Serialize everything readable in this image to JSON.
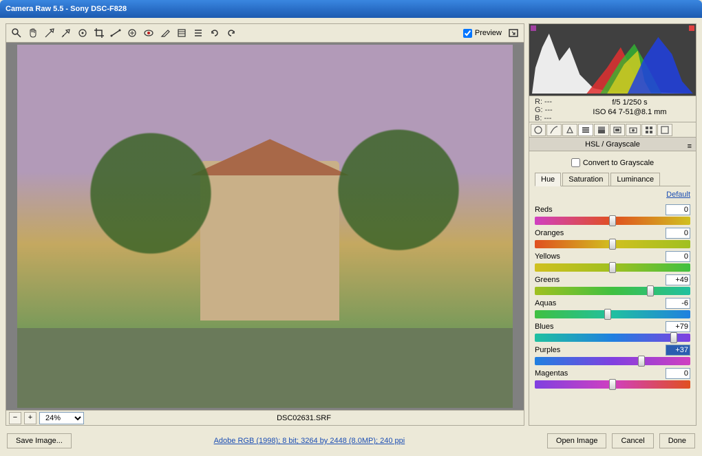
{
  "window": {
    "title": "Camera Raw 5.5  -  Sony DSC-F828"
  },
  "toolbar": {
    "preview_label": "Preview",
    "preview_checked": true
  },
  "zoom": {
    "level": "24%",
    "filename": "DSC02631.SRF"
  },
  "exif": {
    "r": "R:  ---",
    "g": "G:  ---",
    "b": "B:  ---",
    "line1": "f/5   1/250 s",
    "line2": "ISO 64   7-51@8.1 mm"
  },
  "panel": {
    "title": "HSL / Grayscale",
    "grayscale_label": "Convert to Grayscale",
    "grayscale_checked": false,
    "subtabs": [
      "Hue",
      "Saturation",
      "Luminance"
    ],
    "active_subtab": "Hue",
    "default_label": "Default",
    "sliders": [
      {
        "label": "Reds",
        "value": 0,
        "grad": "grad-reds"
      },
      {
        "label": "Oranges",
        "value": 0,
        "grad": "grad-oranges"
      },
      {
        "label": "Yellows",
        "value": 0,
        "grad": "grad-yellows"
      },
      {
        "label": "Greens",
        "value": 49,
        "display": "+49",
        "grad": "grad-greens"
      },
      {
        "label": "Aquas",
        "value": -6,
        "display": "-6",
        "grad": "grad-aquas"
      },
      {
        "label": "Blues",
        "value": 79,
        "display": "+79",
        "grad": "grad-blues"
      },
      {
        "label": "Purples",
        "value": 37,
        "display": "+37",
        "grad": "grad-purples",
        "selected": true
      },
      {
        "label": "Magentas",
        "value": 0,
        "grad": "grad-magentas"
      }
    ]
  },
  "footer": {
    "save": "Save Image...",
    "link": "Adobe RGB (1998); 8 bit; 3264 by 2448 (8.0MP); 240 ppi",
    "open": "Open Image",
    "cancel": "Cancel",
    "done": "Done"
  }
}
